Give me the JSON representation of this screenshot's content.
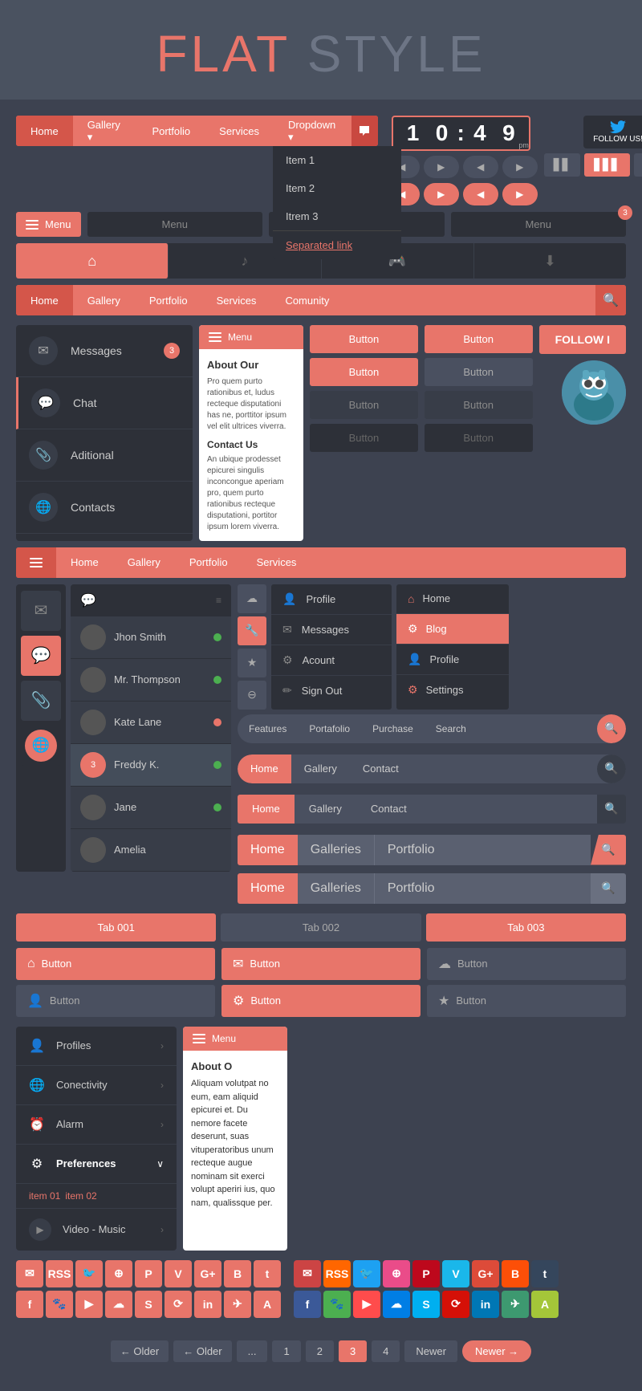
{
  "header": {
    "flat": "FLAT",
    "style": "STYLE"
  },
  "nav1": {
    "items": [
      "Home",
      "Gallery ▾",
      "Portfolio",
      "Services",
      "Dropdown ▾"
    ],
    "dropdown_items": [
      "Item 1",
      "Item 2",
      "Itrem 3",
      "Separated link"
    ],
    "clock": {
      "h1": "1",
      "h2": "0",
      "m1": "4",
      "m2": "9",
      "period": "pm"
    },
    "follow": "FOLLOW US!"
  },
  "nav2": {
    "items": [
      "Home",
      "Gallery",
      "Portfolio",
      "Services",
      "Comunity"
    ],
    "menu_label": "Menu",
    "badge": "3"
  },
  "sidebar": {
    "items": [
      {
        "label": "Messages",
        "badge": "3"
      },
      {
        "label": "Chat"
      },
      {
        "label": "Aditional"
      },
      {
        "label": "Contacts"
      }
    ]
  },
  "mobile_menu": {
    "label": "Menu",
    "about_title": "About Our",
    "about_text": "Pro quem purto rationibus et, ludus recteque disputationi has ne, porttitor ipsum velelit ultrices viverra.",
    "contact_title": "Contact Us",
    "contact_text": "An ubique prodesset epicurei singulis inconcongue aperiam pro, quem purto rationibus recteque disputationi, portitor ipsum lorem viverra."
  },
  "buttons": {
    "button_label": "Button",
    "follow_label": "FOLLOW I"
  },
  "chat_list": {
    "items": [
      {
        "name": "Jhon Smith",
        "status": "green"
      },
      {
        "name": "Mr. Thompson",
        "status": "green"
      },
      {
        "name": "Kate Lane",
        "status": "red"
      },
      {
        "name": "Freddy K.",
        "status": "green",
        "badge": "3"
      },
      {
        "name": "Jane",
        "status": "green"
      },
      {
        "name": "Amelia",
        "status": ""
      }
    ]
  },
  "profile_menu": {
    "items": [
      "Profile",
      "Messages",
      "Acount",
      "Sign Out"
    ]
  },
  "right_menu": {
    "items": [
      "Home",
      "Blog",
      "Profile",
      "Settings"
    ]
  },
  "search_navs": [
    {
      "items": [
        "Features",
        "Portafolio",
        "Purchase",
        "Search"
      ],
      "type": "pill"
    },
    {
      "items": [
        "Home",
        "Gallery",
        "Contact"
      ],
      "type": "pill"
    },
    {
      "items": [
        "Home",
        "Gallery",
        "Contact"
      ],
      "type": "flat"
    },
    {
      "items": [
        "Home",
        "Galleries",
        "Portfolio"
      ],
      "type": "folded"
    },
    {
      "items": [
        "Home",
        "Galleries",
        "Portfolio"
      ],
      "type": "folded2"
    }
  ],
  "tabs": {
    "items": [
      "Tab 001",
      "Tab 002",
      "Tab 003"
    ]
  },
  "icon_buttons": {
    "rows": [
      [
        {
          "label": "Button",
          "type": "red",
          "icon": "home"
        },
        {
          "label": "Button",
          "type": "red",
          "icon": "mail"
        },
        {
          "label": "Button",
          "type": "dark",
          "icon": "cloud"
        }
      ],
      [
        {
          "label": "Button",
          "type": "dark",
          "icon": "person"
        },
        {
          "label": "Button",
          "type": "red",
          "icon": "gear"
        },
        {
          "label": "Button",
          "type": "dark",
          "icon": "star"
        }
      ]
    ]
  },
  "settings": {
    "items": [
      {
        "label": "Profiles",
        "active": false
      },
      {
        "label": "Conectivity",
        "active": false
      },
      {
        "label": "Alarm",
        "active": false
      },
      {
        "label": "Preferences",
        "active": true
      },
      {
        "label": "Video - Music",
        "is_video": true
      }
    ],
    "sub_items": [
      "item 01",
      "item 02"
    ]
  },
  "social_icons": {
    "row1_dark": [
      "✉",
      "RSS",
      "🐦",
      "⊕",
      "P",
      "V",
      "G+",
      "B",
      "t"
    ],
    "row2_dark": [
      "f",
      "🐾",
      "▶",
      "☁",
      "S",
      "⟳",
      "in",
      "✈",
      "A"
    ],
    "row1_color": [
      "✉",
      "RSS",
      "🐦",
      "⊕",
      "P",
      "V",
      "G+",
      "B",
      "t"
    ],
    "row2_color": [
      "f",
      "🐾",
      "▶",
      "☁",
      "S",
      "⟳",
      "in",
      "✈",
      "A"
    ]
  },
  "pagination": {
    "prev": "← Older",
    "older": "← Older",
    "pages": [
      "1",
      "2",
      "3",
      "4"
    ],
    "newer": "Newer",
    "next": "Newer →"
  },
  "colors": {
    "red": "#e8756a",
    "dark_bg": "#2d3038",
    "mid_bg": "#383d48",
    "panel_bg": "#4a5060",
    "accent": "#e8756a"
  }
}
